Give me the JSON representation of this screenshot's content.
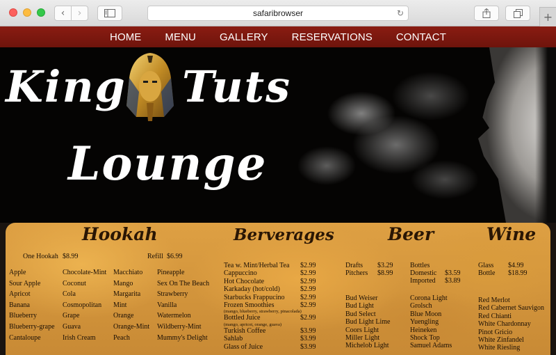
{
  "browser": {
    "address": "safaribrowser",
    "back_glyph": "‹",
    "forward_glyph": "›",
    "reload_glyph": "↻",
    "new_tab_glyph": "+",
    "icons": [
      "back-icon",
      "forward-icon",
      "sidebar-icon",
      "reload-icon",
      "share-icon",
      "tabs-icon",
      "new-tab-icon"
    ]
  },
  "nav": {
    "items": [
      "HOME",
      "MENU",
      "GALLERY",
      "RESERVATIONS",
      "CONTACT"
    ],
    "background": "#7d1910"
  },
  "hero": {
    "logo_line1_a": "King",
    "logo_line1_b": "Tuts",
    "logo_line2": "Lounge"
  },
  "menu": {
    "hookah": {
      "title": "Hookah",
      "one_hookah_label": "One Hookah",
      "one_hookah_price": "$8.99",
      "refill_label": "Refill",
      "refill_price": "$6.99",
      "col1": [
        "Apple",
        "Sour Apple",
        "Apricot",
        "Banana",
        "Blueberry",
        "Blueberry-grape",
        "Cantaloupe"
      ],
      "col2": [
        "Chocolate-Mint",
        "Coconut",
        "Cola",
        "Cosmopolitan",
        "Grape",
        "Guava",
        "Irish Cream"
      ],
      "col3": [
        "Macchiato",
        "Mango",
        "Margarita",
        "Mint",
        "Orange",
        "Orange-Mint",
        "Peach"
      ],
      "col4": [
        "Pineapple",
        "Sex On The Beach",
        "Strawberry",
        "Vanilla",
        "Watermelon",
        "Wildberry-Mint",
        "Mummy's Delight"
      ]
    },
    "beverages": {
      "title": "Berverages",
      "items": [
        {
          "name": "Tea w. Mint/Herbal Tea",
          "price": "$2.99"
        },
        {
          "name": "Cappuccino",
          "price": "$2.99"
        },
        {
          "name": "Hot Chocolate",
          "price": "$2.99"
        },
        {
          "name": "Karkaday (hot/cold)",
          "price": "$2.99"
        },
        {
          "name": "Starbucks Frappucino",
          "price": "$2.99"
        },
        {
          "name": "Frozen Smoothies",
          "price": "$2.99"
        },
        {
          "name": "(mango, blueberry, strawberry, pinacolada)",
          "price": ""
        },
        {
          "name": "Bottled Juice",
          "price": "$2.99"
        },
        {
          "name": "(mango, apricot, orange, guava)",
          "price": ""
        },
        {
          "name": "Turkish Coffee",
          "price": "$3.99"
        },
        {
          "name": "Sahlab",
          "price": "$3.99"
        },
        {
          "name": "Glass of Juice",
          "price": "$3.99"
        }
      ]
    },
    "beer": {
      "title": "Beer",
      "drafts_label": "Drafts",
      "drafts_price": "$3.29",
      "pitchers_label": "Pitchers",
      "pitchers_price": "$8.99",
      "bottles_label": "Bottles",
      "domestic_label": "Domestic",
      "domestic_price": "$3.59",
      "imported_label": "Imported",
      "imported_price": "$3.89",
      "col1": [
        "Bud Weiser",
        "Bud Light",
        "Bud Select",
        "Bud Light Lime",
        "Coors Light",
        "Miller Light",
        "Michelob Light"
      ],
      "col2": [
        "Corona Light",
        "Grolsch",
        "Blue Moon",
        "Yuengling",
        "Heineken",
        "Shock Top",
        "Samuel Adams"
      ]
    },
    "wine": {
      "title": "Wine",
      "glass_label": "Glass",
      "glass_price": "$4.99",
      "bottle_label": "Bottle",
      "bottle_price": "$18.99",
      "items": [
        "Red Merlot",
        "Red Cabernet Sauvigon",
        "Red Chianti",
        "White Chardonnay",
        "Pinot Gricio",
        "White Zinfandel",
        "White Riesling"
      ]
    }
  }
}
